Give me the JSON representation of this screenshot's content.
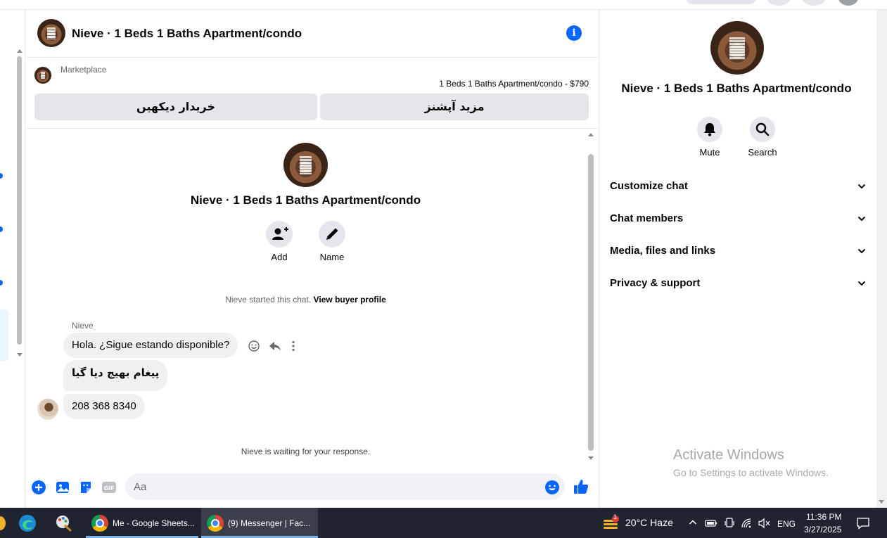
{
  "chat": {
    "title": "Nieve · 1 Beds 1 Baths Apartment/condo"
  },
  "marketplace": {
    "label": "Marketplace",
    "listing": "1 Beds 1 Baths Apartment/condo - $790",
    "buttons": [
      "خریدار دیکھیں",
      "مزید آپشنز"
    ]
  },
  "thread": {
    "title": "Nieve · 1 Beds 1 Baths Apartment/condo",
    "actions": [
      {
        "label": "Add",
        "icon": "add-person-icon"
      },
      {
        "label": "Name",
        "icon": "pencil-icon"
      }
    ],
    "started_text": "Nieve started this chat.",
    "view_profile": "View buyer profile",
    "sender": "Nieve",
    "messages": [
      "Hola. ¿Sigue estando disponible?",
      "پیغام بھیج دیا گیا",
      "208 368 8340"
    ],
    "waiting": "Nieve is waiting for your response."
  },
  "composer": {
    "placeholder": "Aa"
  },
  "info_panel": {
    "title": "Nieve · 1 Beds 1 Baths Apartment/condo",
    "actions": [
      {
        "label": "Mute",
        "icon": "bell-icon"
      },
      {
        "label": "Search",
        "icon": "search-icon"
      }
    ],
    "sections": [
      "Customize chat",
      "Chat members",
      "Media, files and links",
      "Privacy & support"
    ]
  },
  "watermark": {
    "title": "Activate Windows",
    "subtitle": "Go to Settings to activate Windows."
  },
  "taskbar": {
    "apps": [
      "Me - Google Sheets...",
      "(9) Messenger | Fac..."
    ],
    "weather": "20°C  Haze",
    "weather_badge": "1",
    "language": "ENG",
    "time": "11:36 PM",
    "date": "3/27/2025"
  },
  "colors": {
    "accent": "#0866ff",
    "bubble": "#f0f0f0",
    "button_gray": "#e4e6eb",
    "taskbar": "#1f2430"
  }
}
